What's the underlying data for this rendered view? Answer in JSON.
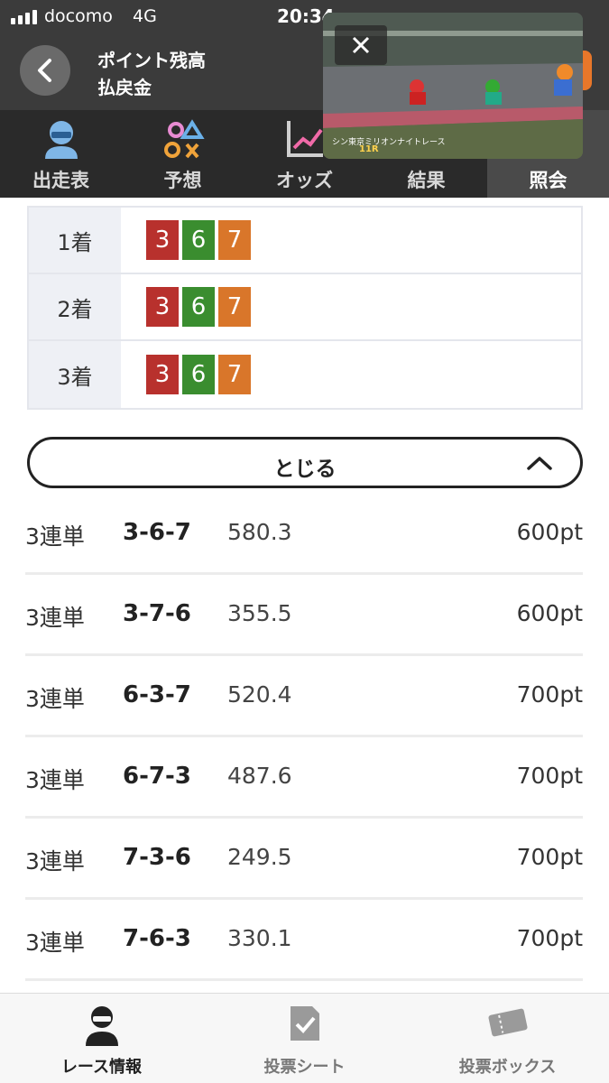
{
  "status_bar": {
    "carrier": "docomo",
    "network": "4G",
    "time": "20:34"
  },
  "header": {
    "title_line1": "ポイント残高",
    "title_line2": "払戻金"
  },
  "tabs": [
    {
      "label": "出走表",
      "icon": "racer-icon",
      "active": false
    },
    {
      "label": "予想",
      "icon": "symbols-icon",
      "active": false
    },
    {
      "label": "オッズ",
      "icon": "trend-chart-icon",
      "active": false
    },
    {
      "label": "結果",
      "icon": "",
      "active": false
    },
    {
      "label": "照会",
      "icon": "",
      "active": true
    }
  ],
  "video": {
    "close_icon": "close-icon",
    "caption": "シン東京ミリオンナイトレース",
    "race": "11R"
  },
  "arrivals": [
    {
      "position": "1着",
      "chips": [
        "3",
        "6",
        "7"
      ]
    },
    {
      "position": "2着",
      "chips": [
        "3",
        "6",
        "7"
      ]
    },
    {
      "position": "3着",
      "chips": [
        "3",
        "6",
        "7"
      ]
    }
  ],
  "chip_colors": {
    "3": "#b8312d",
    "6": "#3a8d2f",
    "7": "#d9762a"
  },
  "toggle": {
    "label": "とじる",
    "icon": "chevron-up-icon"
  },
  "bets": [
    {
      "type": "3連単",
      "combo": "3-6-7",
      "odds": "580.3",
      "points": "600pt"
    },
    {
      "type": "3連単",
      "combo": "3-7-6",
      "odds": "355.5",
      "points": "600pt"
    },
    {
      "type": "3連単",
      "combo": "6-3-7",
      "odds": "520.4",
      "points": "700pt"
    },
    {
      "type": "3連単",
      "combo": "6-7-3",
      "odds": "487.6",
      "points": "700pt"
    },
    {
      "type": "3連単",
      "combo": "7-3-6",
      "odds": "249.5",
      "points": "700pt"
    },
    {
      "type": "3連単",
      "combo": "7-6-3",
      "odds": "330.1",
      "points": "700pt"
    }
  ],
  "bottom_nav": [
    {
      "label": "レース情報",
      "icon": "racer-icon",
      "active": true
    },
    {
      "label": "投票シート",
      "icon": "checkmark-sheet-icon",
      "active": false
    },
    {
      "label": "投票ボックス",
      "icon": "ticket-icon",
      "active": false
    }
  ]
}
